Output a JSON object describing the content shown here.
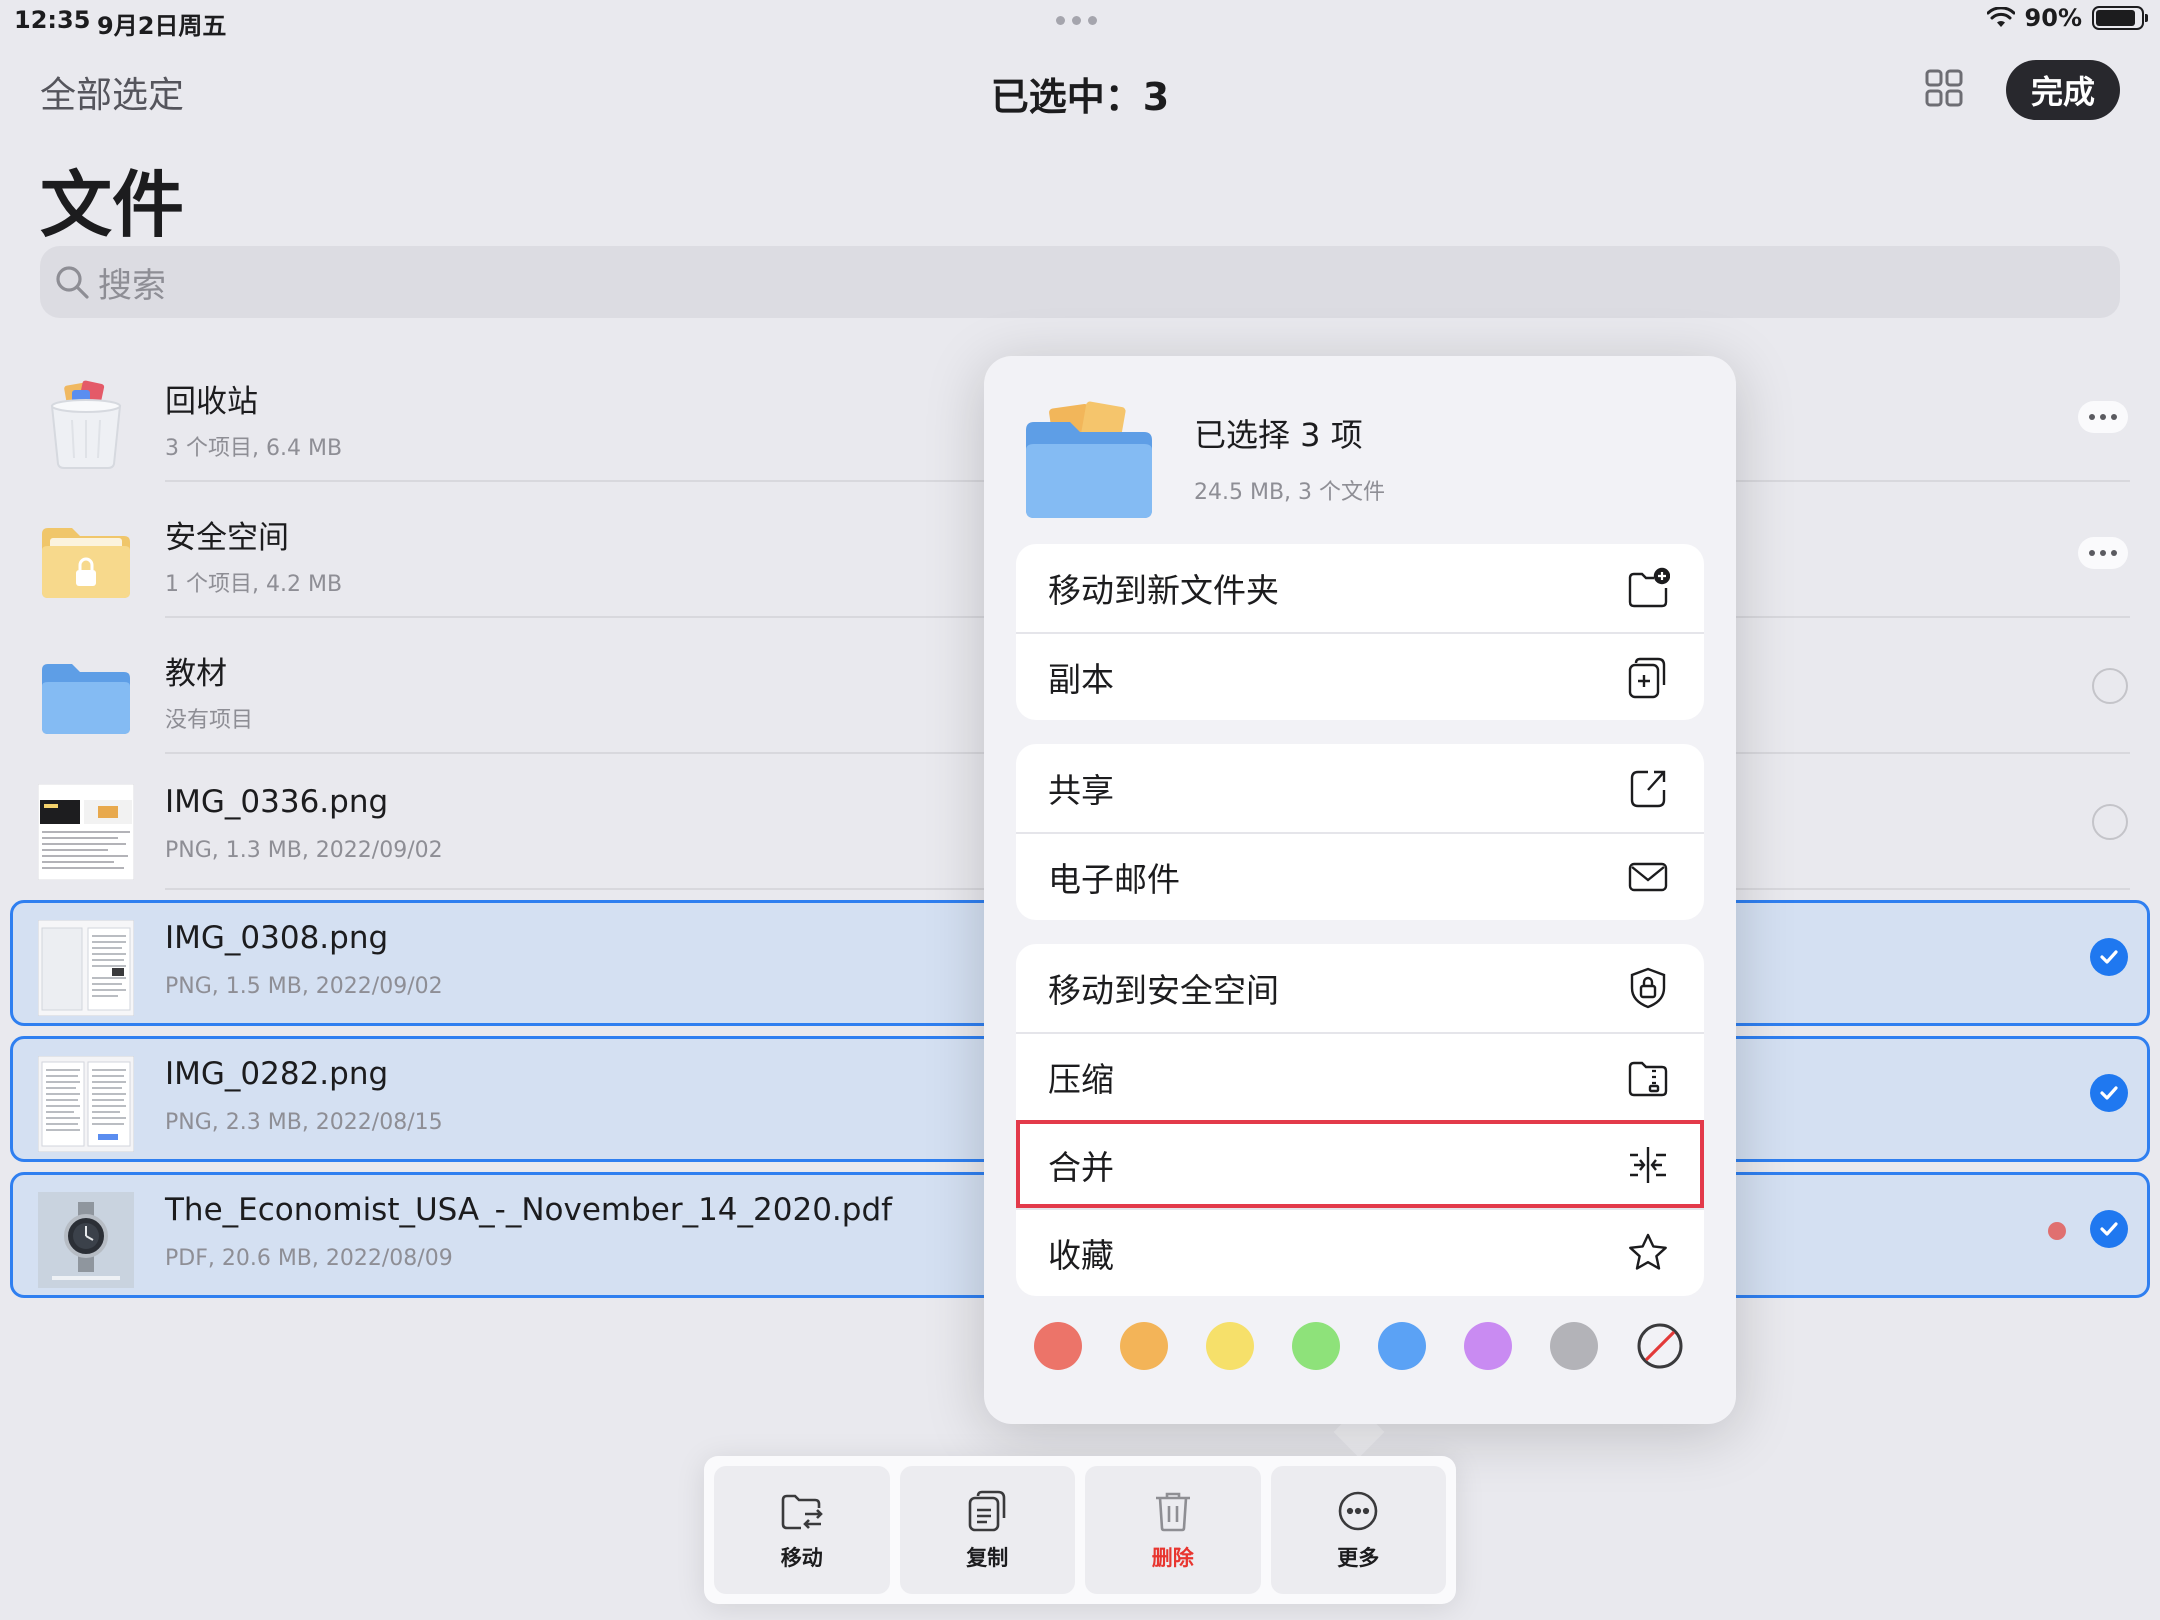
{
  "status_bar": {
    "time": "12:35",
    "date": "9月2日周五",
    "battery": "90%"
  },
  "nav": {
    "select_all": "全部选定",
    "title": "已选中：3",
    "done": "完成",
    "grid_icon": "grid-icon"
  },
  "page": {
    "title": "文件",
    "search_placeholder": "搜索"
  },
  "files": [
    {
      "name": "回收站",
      "meta": "3 个项目, 6.4 MB",
      "icon": "trash-bin-icon",
      "state": "more"
    },
    {
      "name": "安全空间",
      "meta": "1 个项目, 4.2 MB",
      "icon": "locked-folder-icon",
      "state": "more"
    },
    {
      "name": "教材",
      "meta": "没有项目",
      "icon": "folder-icon",
      "state": "unselected"
    },
    {
      "name": "IMG_0336.png",
      "meta": "PNG, 1.3 MB, 2022/09/02",
      "icon": "image-thumbnail",
      "state": "unselected"
    },
    {
      "name": "IMG_0308.png",
      "meta": "PNG, 1.5 MB, 2022/09/02",
      "icon": "image-thumbnail",
      "state": "selected"
    },
    {
      "name": "IMG_0282.png",
      "meta": "PNG, 2.3 MB, 2022/08/15",
      "icon": "image-thumbnail",
      "state": "selected"
    },
    {
      "name": "The_Economist_USA_-_November_14_2020.pdf",
      "meta": "PDF, 20.6 MB, 2022/08/09",
      "icon": "pdf-thumbnail",
      "state": "selected",
      "tag_color": "#e07070"
    }
  ],
  "popover": {
    "title": "已选择 3 项",
    "subtitle": "24.5 MB, 3 个文件",
    "groups": [
      [
        {
          "label": "移动到新文件夹",
          "icon": "new-folder-icon"
        },
        {
          "label": "副本",
          "icon": "duplicate-icon"
        }
      ],
      [
        {
          "label": "共享",
          "icon": "share-icon"
        },
        {
          "label": "电子邮件",
          "icon": "mail-icon"
        }
      ],
      [
        {
          "label": "移动到安全空间",
          "icon": "lock-shield-icon"
        },
        {
          "label": "压缩",
          "icon": "zip-folder-icon"
        },
        {
          "label": "合并",
          "icon": "merge-icon",
          "highlighted": true
        },
        {
          "label": "收藏",
          "icon": "star-icon"
        }
      ]
    ],
    "tag_colors": [
      "#ec7469",
      "#f3b458",
      "#f6e06a",
      "#8ee27a",
      "#5ba2f5",
      "#c98bf2",
      "#b3b3b8",
      "none"
    ]
  },
  "toolbar": {
    "move": "移动",
    "copy": "复制",
    "delete": "删除",
    "more": "更多"
  }
}
